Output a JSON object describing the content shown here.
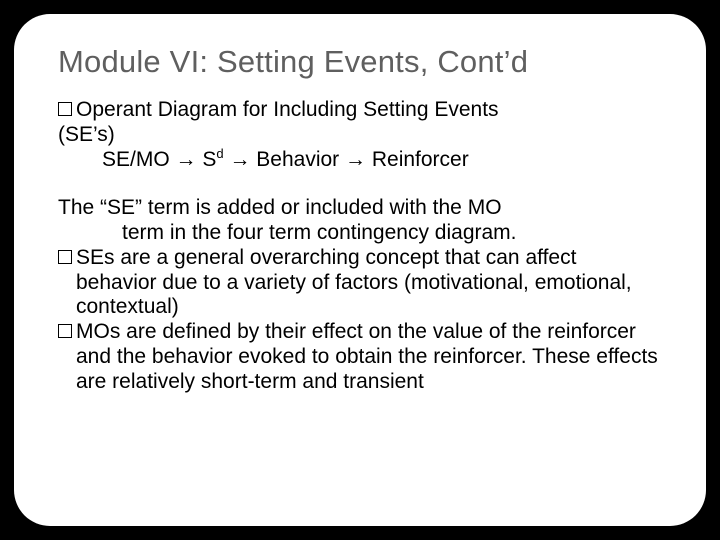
{
  "title": "Module VI: Setting Events, Cont’d",
  "b1_lead": "Operant Diagram for Including Setting Events",
  "b1_cont": "(SE’s)",
  "chain_pre": "SE/MO ",
  "arrow": "→",
  "chain_sd_pre": " S",
  "chain_sd_sup": "d",
  "chain_sd_post": " ",
  "chain_beh": " Behavior ",
  "chain_reinf": " Reinforcer",
  "p1": "The “SE” term is added or included with the MO",
  "p1b": "term in the four term contingency diagram.",
  "b2": "SEs are a general overarching concept that can affect behavior due to a variety of factors (motivational, emotional, contextual)",
  "b3": "MOs are defined by their effect on the value of the reinforcer and the behavior evoked to obtain the reinforcer.  These effects are relatively short-term and transient"
}
